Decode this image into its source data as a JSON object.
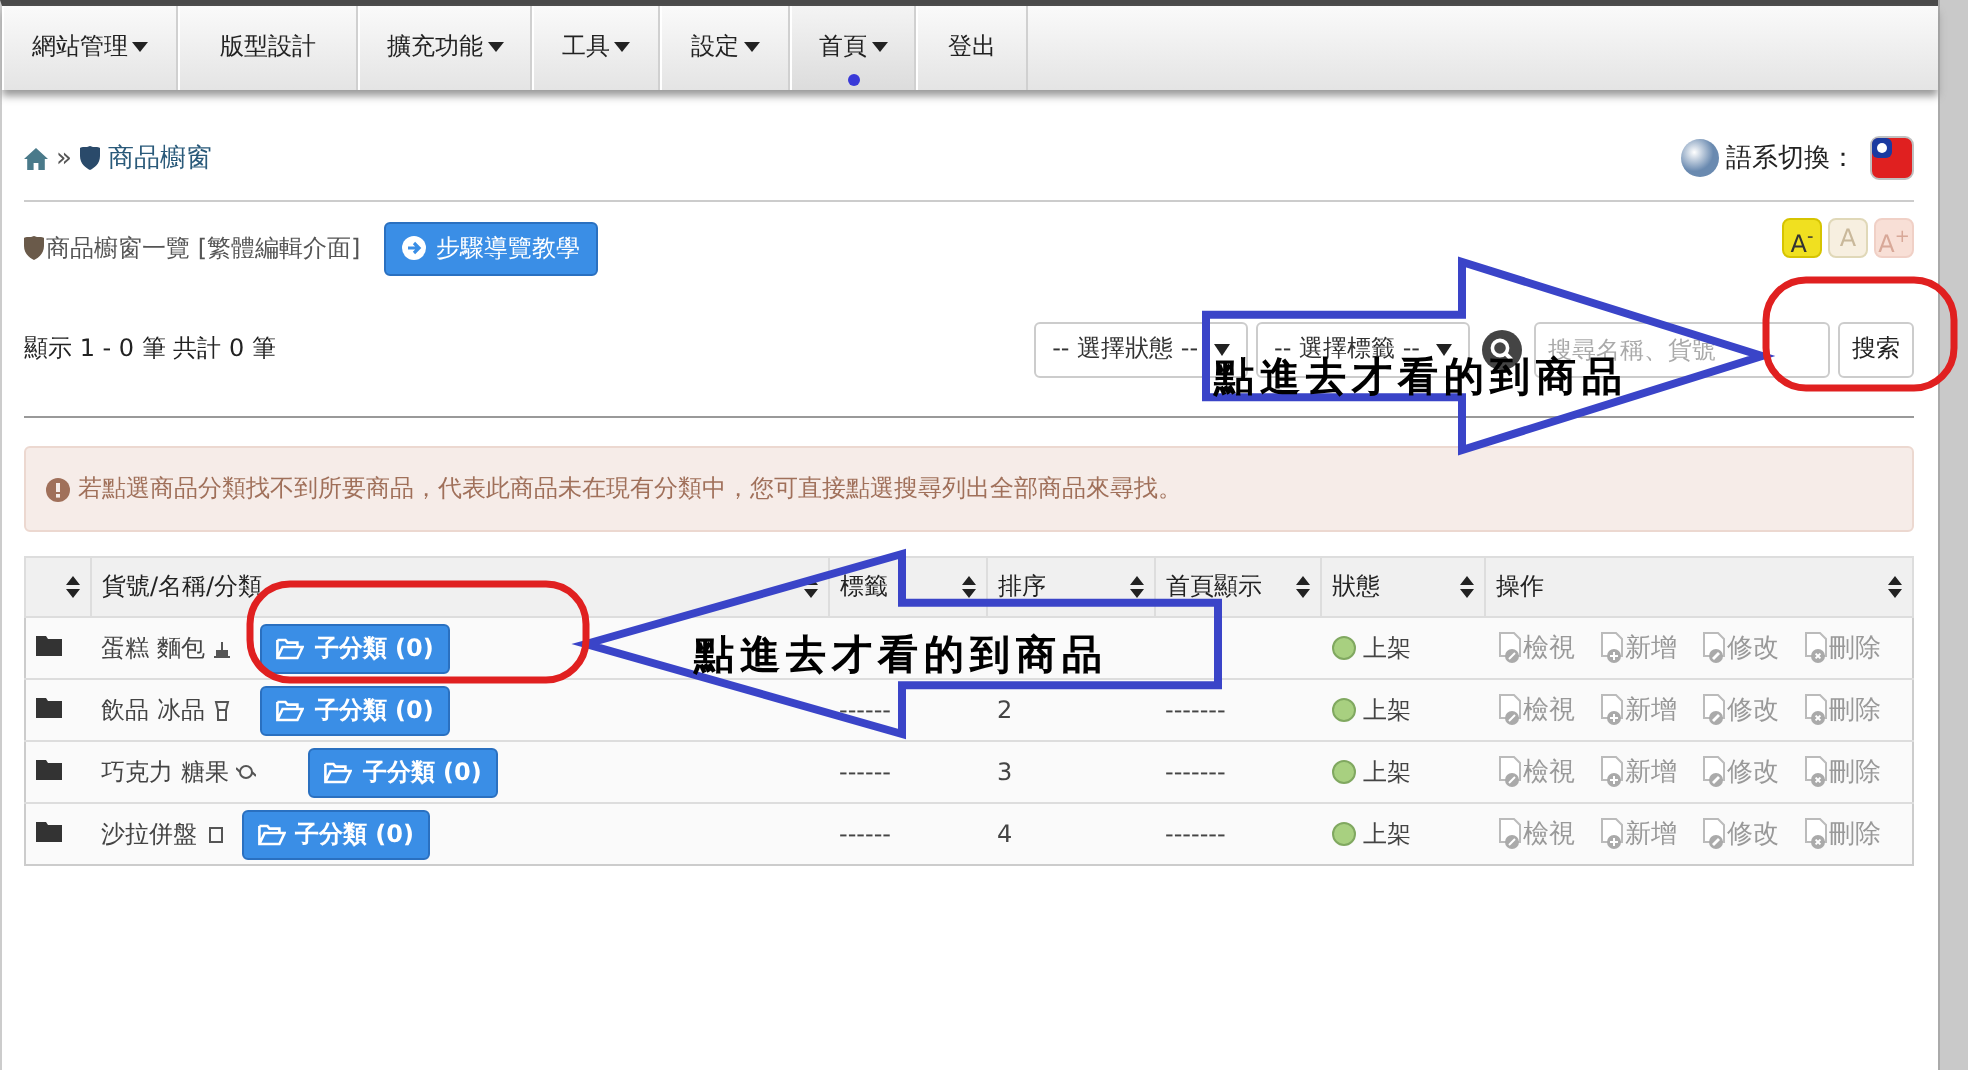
{
  "nav": {
    "items": [
      {
        "label": "網站管理",
        "dropdown": true,
        "selected": false
      },
      {
        "label": "版型設計",
        "dropdown": false,
        "selected": false
      },
      {
        "label": "擴充功能",
        "dropdown": true,
        "selected": false
      },
      {
        "label": "工具",
        "dropdown": true,
        "selected": false
      },
      {
        "label": "設定",
        "dropdown": true,
        "selected": false
      },
      {
        "label": "首頁",
        "dropdown": true,
        "selected": true
      },
      {
        "label": "登出",
        "dropdown": false,
        "selected": false
      }
    ]
  },
  "breadcrumb": {
    "separator": "»",
    "current": "商品櫥窗"
  },
  "language": {
    "label": "語系切換："
  },
  "page_title": "商品櫥窗一覽 [繁體編輯介面]",
  "tour_button": "步驟導覽教學",
  "font_size_buttons": [
    {
      "label": "A$^{-}$",
      "kind": "smaller",
      "selected": true
    },
    {
      "label": "A",
      "kind": "normal",
      "selected": false
    },
    {
      "label": "A$^{+}$",
      "kind": "larger",
      "selected": false
    }
  ],
  "record_count": "顯示 1 - 0 筆 共計 0 筆",
  "filters": {
    "status_select": "-- 選擇狀態 --",
    "tag_select": "-- 選擇標籤 --",
    "search": {
      "placeholder": "搜尋名稱、貨號"
    },
    "search_button": "搜索"
  },
  "alert": "若點選商品分類找不到所要商品，代表此商品未在現有分類中，您可直接點選搜尋列出全部商品來尋找。",
  "table": {
    "columns": [
      "貨號/名稱/分類",
      "標籤",
      "排序",
      "首頁顯示",
      "狀態",
      "操作"
    ],
    "rows": [
      {
        "name": "蛋糕 麵包",
        "subcategory_button": "子分類 (0)",
        "status": "上架",
        "actions": [
          "檢視",
          "新增",
          "修改",
          "刪除"
        ]
      },
      {
        "name": "飲品 冰品",
        "subcategory_button": "子分類 (0)",
        "tag": "------",
        "order": "2",
        "homepage": "-------",
        "status": "上架",
        "actions": [
          "檢視",
          "新增",
          "修改",
          "刪除"
        ]
      },
      {
        "name": "巧克力 糖果",
        "subcategory_button": "子分類 (0)",
        "tag": "------",
        "order": "3",
        "homepage": "-------",
        "status": "上架",
        "actions": [
          "檢視",
          "新增",
          "修改",
          "刪除"
        ]
      },
      {
        "name": "沙拉併盤",
        "subcategory_button": "子分類 (0)",
        "tag": "------",
        "order": "4",
        "homepage": "-------",
        "status": "上架",
        "actions": [
          "檢視",
          "新增",
          "修改",
          "刪除"
        ]
      }
    ]
  },
  "annotations": [
    {
      "text": "點進去才看的到商品",
      "kind": "right_arrow"
    },
    {
      "text": "點進去才看的到商品",
      "kind": "left_arrow"
    }
  ]
}
